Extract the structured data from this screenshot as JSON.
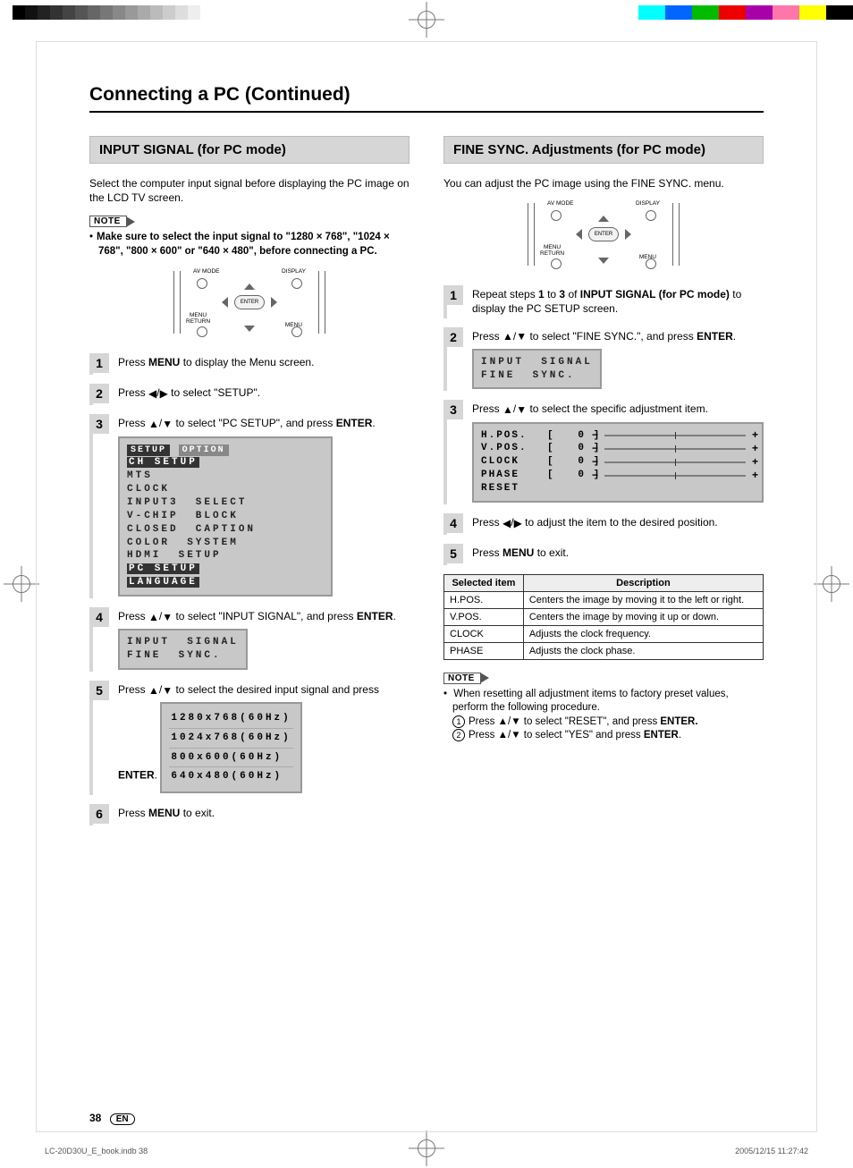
{
  "page_title": "Connecting a PC (Continued)",
  "left": {
    "heading": "INPUT SIGNAL (for PC mode)",
    "intro": "Select the computer input signal before displaying the PC image on the LCD TV screen.",
    "note_bullet": "Make sure to select the input signal to \"1280 × 768\", \"1024 × 768\", \"800 × 600\" or  \"640 × 480\", before connecting a PC.",
    "steps": {
      "s1": "Press MENU to display the Menu screen.",
      "s2": "Press ◀/▶ to select \"SETUP\".",
      "s3": "Press ▲/▼ to select \"PC SETUP\", and press ENTER.",
      "s4": "Press ▲/▼ to select \"INPUT SIGNAL\", and press ENTER.",
      "s5": "Press ▲/▼ to select the desired input signal and press ENTER.",
      "s6": "Press MENU to exit."
    },
    "osd_setup": {
      "tab1": "SETUP",
      "tab2": "OPTION",
      "items": [
        "CH  SETUP",
        "MTS",
        "CLOCK",
        "INPUT3  SELECT",
        "V-CHIP  BLOCK",
        "CLOSED  CAPTION",
        "COLOR  SYSTEM",
        "HDMI  SETUP",
        "PC  SETUP",
        "LANGUAGE"
      ]
    },
    "osd_input": {
      "l1": "INPUT  SIGNAL",
      "l2": "FINE  SYNC."
    },
    "resolutions": [
      "1280x768(60Hz)",
      "1024x768(60Hz)",
      "800x600(60Hz)",
      "640x480(60Hz)"
    ]
  },
  "right": {
    "heading": "FINE SYNC. Adjustments (for PC mode)",
    "intro": "You can adjust the PC image using the FINE SYNC. menu.",
    "steps": {
      "s1": "Repeat steps 1 to 3 of INPUT SIGNAL (for PC mode) to display the PC SETUP screen.",
      "s2": "Press ▲/▼ to select \"FINE SYNC.\", and press ENTER.",
      "s3": "Press ▲/▼ to select the specific adjustment item.",
      "s4": "Press ◀/▶ to adjust the item to the desired position.",
      "s5": "Press MENU to exit."
    },
    "osd_input": {
      "l1": "INPUT  SIGNAL",
      "l2": "FINE  SYNC."
    },
    "adjust": [
      {
        "name": "H.POS.",
        "val": "0"
      },
      {
        "name": "V.POS.",
        "val": "0"
      },
      {
        "name": "CLOCK",
        "val": "0"
      },
      {
        "name": "PHASE",
        "val": "0"
      }
    ],
    "adjust_reset": "RESET",
    "table": {
      "h1": "Selected item",
      "h2": "Description",
      "rows": [
        {
          "k": "H.POS.",
          "v": "Centers the image by moving it to the left or right."
        },
        {
          "k": "V.POS.",
          "v": "Centers the image by moving it up or down."
        },
        {
          "k": "CLOCK",
          "v": "Adjusts the clock frequency."
        },
        {
          "k": "PHASE",
          "v": "Adjusts the clock phase."
        }
      ]
    },
    "note_lines": {
      "intro": "When resetting all adjustment items to factory preset values, perform the following procedure.",
      "a": "Press ▲/▼ to select \"RESET\", and press ENTER.",
      "b": "Press ▲/▼ to select \"YES\" and press ENTER."
    }
  },
  "remote": {
    "av": "AV MODE",
    "disp": "DISPLAY",
    "menu_ret": "MENU\nRETURN",
    "menu": "MENU",
    "enter": "ENTER"
  },
  "note_label": "NOTE",
  "footer": {
    "page": "38",
    "lang": "EN",
    "file": "LC-20D30U_E_book.indb   38",
    "date": "2005/12/15   11:27:42"
  }
}
